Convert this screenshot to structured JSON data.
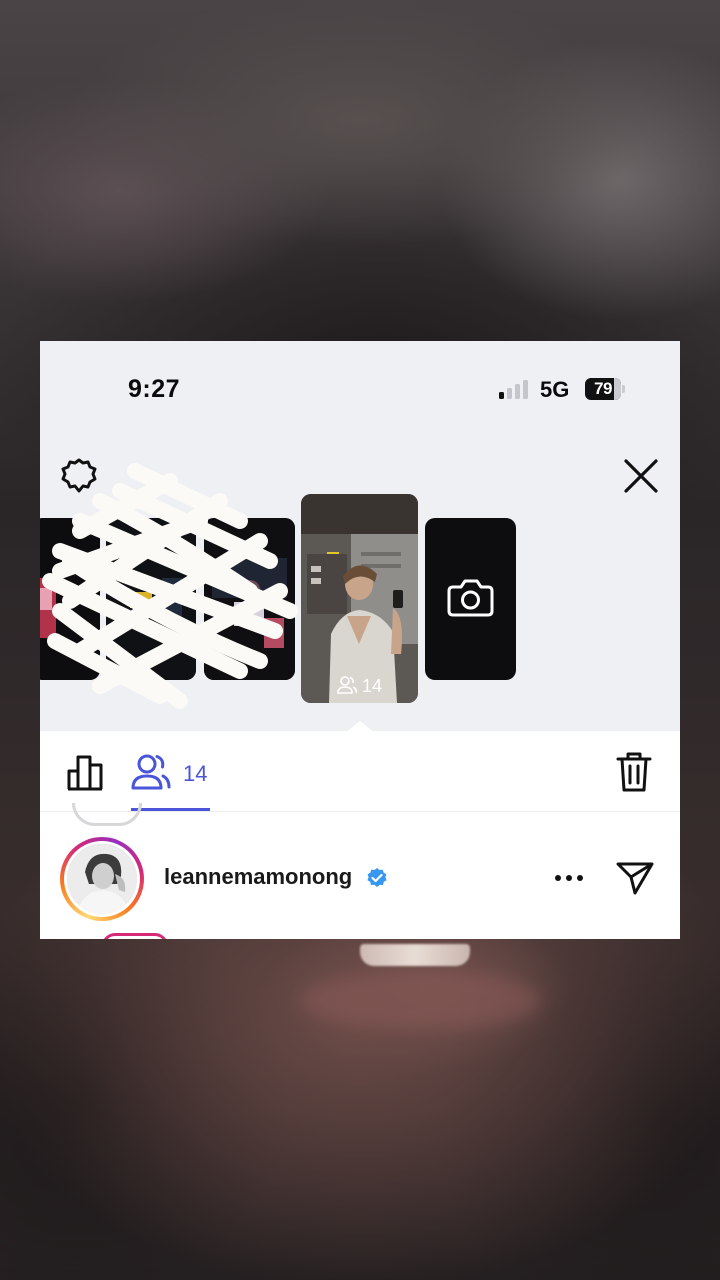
{
  "status_bar": {
    "time": "9:27",
    "network": "5G",
    "battery": "79"
  },
  "story_tray": {
    "active_viewer_count": "14"
  },
  "tabs": {
    "viewers_count": "14"
  },
  "viewer_row": {
    "username": "leannemamonong",
    "verified": true
  },
  "icons": {
    "settings": "gear-icon",
    "close": "close-icon",
    "camera": "camera-icon",
    "insights": "bar-chart-icon",
    "viewers": "people-icon",
    "delete": "trash-icon",
    "more": "more-dots-icon",
    "send": "send-icon",
    "verified": "verified-badge-icon"
  },
  "colors": {
    "accent": "#4a55d9",
    "verified": "#3897f0",
    "tray_background": "#eef0f4"
  }
}
